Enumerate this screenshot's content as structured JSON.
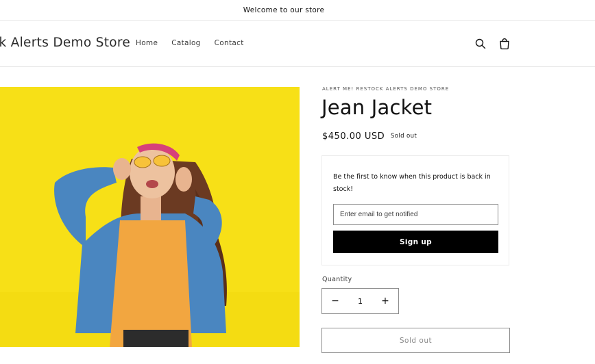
{
  "announcement": {
    "text": "Welcome to our store"
  },
  "header": {
    "logo": "ck Alerts Demo Store",
    "nav": [
      {
        "label": "Home"
      },
      {
        "label": "Catalog"
      },
      {
        "label": "Contact"
      }
    ],
    "icons": [
      "search-icon",
      "cart-icon"
    ]
  },
  "product": {
    "image_alt": "woman in denim jacket on yellow background",
    "vendor": "ALERT ME! RESTOCK ALERTS DEMO STORE",
    "title": "Jean Jacket",
    "price": "$450.00 USD",
    "badge": "Sold out",
    "colors": {
      "image_bg": "#f7e017",
      "jacket": "#4a86c0",
      "shirt": "#f2a640"
    }
  },
  "restock_alert": {
    "text": "Be the first to know when this product is back in stock!",
    "email_placeholder": "Enter email to get notified",
    "signup_label": "Sign up"
  },
  "quantity": {
    "label": "Quantity",
    "minus": "−",
    "value": "1",
    "plus": "+"
  },
  "buy_button": {
    "label": "Sold out"
  }
}
